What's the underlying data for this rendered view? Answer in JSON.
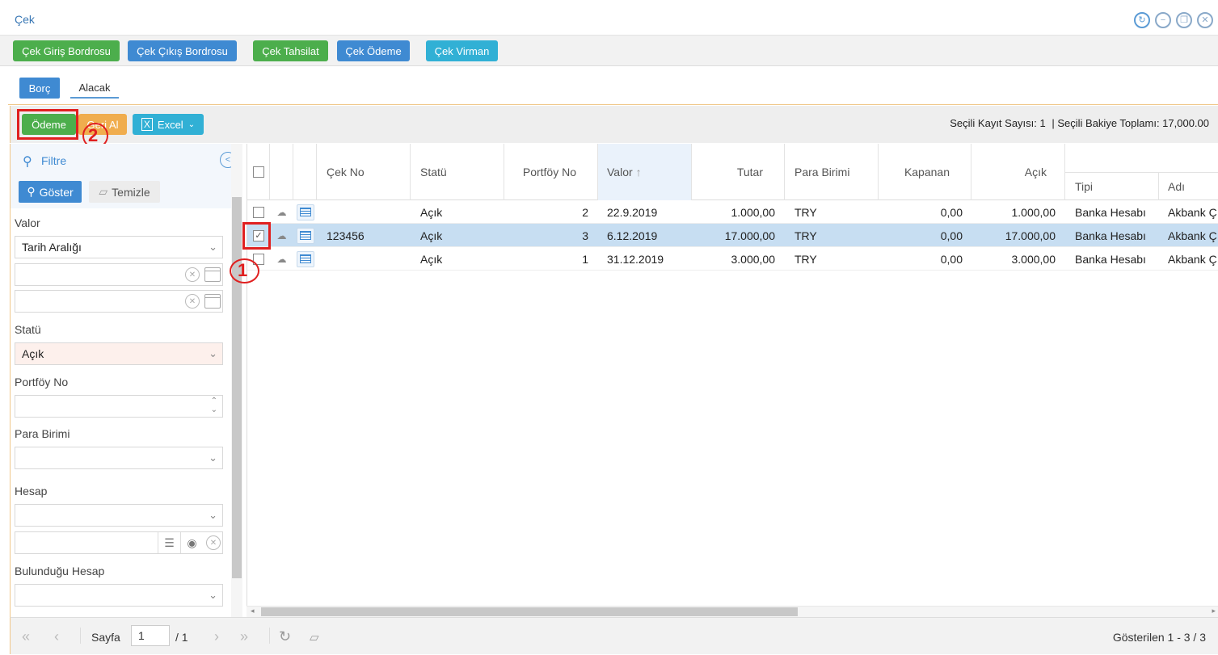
{
  "window": {
    "title": "Çek"
  },
  "top_toolbar": {
    "buttons": [
      "Çek Giriş Bordrosu",
      "Çek Çıkış Bordrosu",
      "Çek Tahsilat",
      "Çek Ödeme",
      "Çek Virman"
    ]
  },
  "tabs": [
    "Borç",
    "Alacak"
  ],
  "actions": {
    "odeme": "Ödeme",
    "geri_al": "Geri Al",
    "excel": "Excel",
    "selected_count": "Seçili Kayıt Sayısı: 1",
    "selected_total": "| Seçili Bakiye Toplamı: 17,000.00"
  },
  "filter": {
    "title": "Filtre",
    "show": "Göster",
    "clear": "Temizle",
    "valor_label": "Valor",
    "valor_value": "Tarih Aralığı",
    "statu_label": "Statü",
    "statu_value": "Açık",
    "portfoy_label": "Portföy No",
    "para_label": "Para Birimi",
    "hesap_label": "Hesap",
    "bulundugu_label": "Bulunduğu Hesap"
  },
  "grid": {
    "columns": [
      "Çek No",
      "Statü",
      "Portföy No",
      "Valor",
      "Tutar",
      "Para Birimi",
      "Kapanan",
      "Açık",
      "Tipi",
      "Adı"
    ],
    "rows": [
      {
        "cek_no": "",
        "statu": "Açık",
        "portfoy": "2",
        "valor": "22.9.2019",
        "tutar": "1.000,00",
        "para": "TRY",
        "kapanan": "0,00",
        "acik": "1.000,00",
        "tipi": "Banka Hesabı",
        "adi": "Akbank Ç",
        "checked": false
      },
      {
        "cek_no": "123456",
        "statu": "Açık",
        "portfoy": "3",
        "valor": "6.12.2019",
        "tutar": "17.000,00",
        "para": "TRY",
        "kapanan": "0,00",
        "acik": "17.000,00",
        "tipi": "Banka Hesabı",
        "adi": "Akbank Ç",
        "checked": true
      },
      {
        "cek_no": "",
        "statu": "Açık",
        "portfoy": "1",
        "valor": "31.12.2019",
        "tutar": "3.000,00",
        "para": "TRY",
        "kapanan": "0,00",
        "acik": "3.000,00",
        "tipi": "Banka Hesabı",
        "adi": "Akbank Ç",
        "checked": false
      }
    ]
  },
  "pager": {
    "page_label": "Sayfa",
    "page_value": "1",
    "total_pages": "/ 1",
    "shown": "Gösterilen 1 - 3 / 3"
  },
  "annotations": {
    "step1": "1",
    "step2": "2"
  },
  "colors": {
    "primary": "#3f8ad2",
    "success": "#4cae4c",
    "info": "#31b0d5",
    "warning": "#f0ad4e",
    "annotation": "#e02020"
  }
}
